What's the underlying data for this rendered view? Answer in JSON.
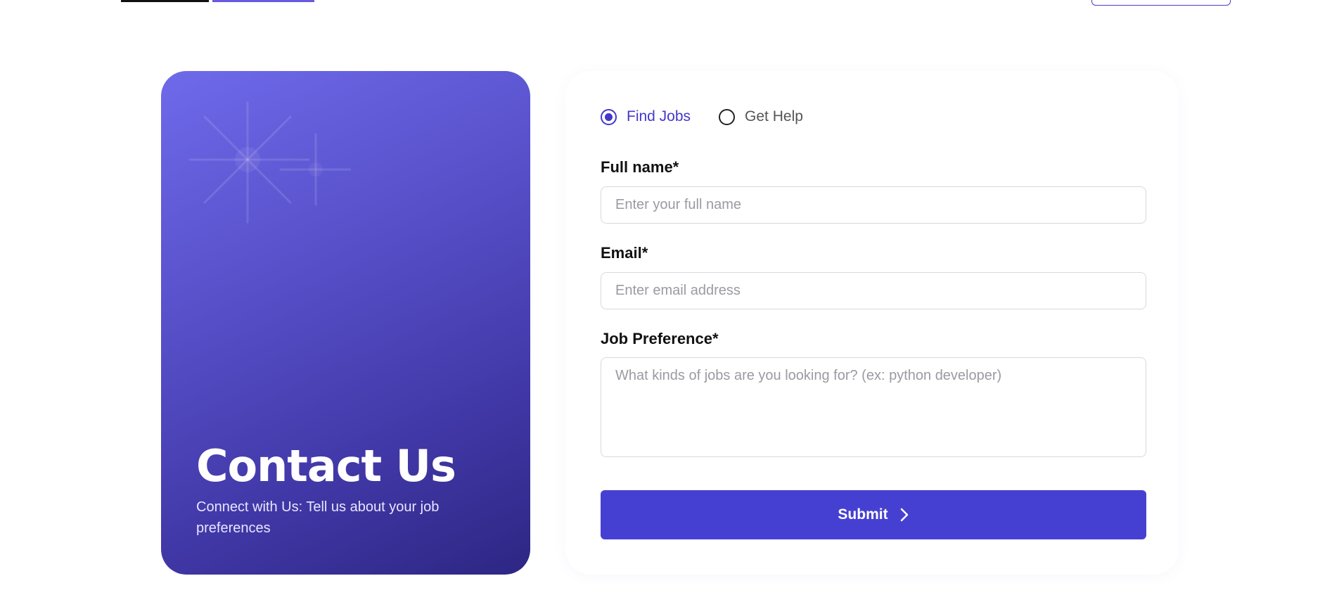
{
  "header": {
    "logo_icon": "brand-logo",
    "action_button_icon": "header-button"
  },
  "hero": {
    "title": "Contact Us",
    "subtitle": "Connect with Us: Tell us about your job preferences",
    "decoration_icon": "sparkle-icon",
    "colors": {
      "gradient_start": "#6e6aea",
      "gradient_end": "#2e2683"
    }
  },
  "form": {
    "mode_options": [
      {
        "label": "Find Jobs",
        "checked": true
      },
      {
        "label": "Get Help",
        "checked": false
      }
    ],
    "full_name": {
      "label": "Full name*",
      "placeholder": "Enter your full name",
      "value": ""
    },
    "email": {
      "label": "Email*",
      "placeholder": "Enter email address",
      "value": ""
    },
    "job_preference": {
      "label": "Job Preference*",
      "placeholder": "What kinds of jobs are you looking for? (ex: python developer)",
      "value": ""
    },
    "submit": {
      "label": "Submit",
      "icon": "chevron-right-icon"
    },
    "colors": {
      "accent": "#4338ca",
      "button": "#4640d2",
      "border": "#d9d9de"
    }
  }
}
